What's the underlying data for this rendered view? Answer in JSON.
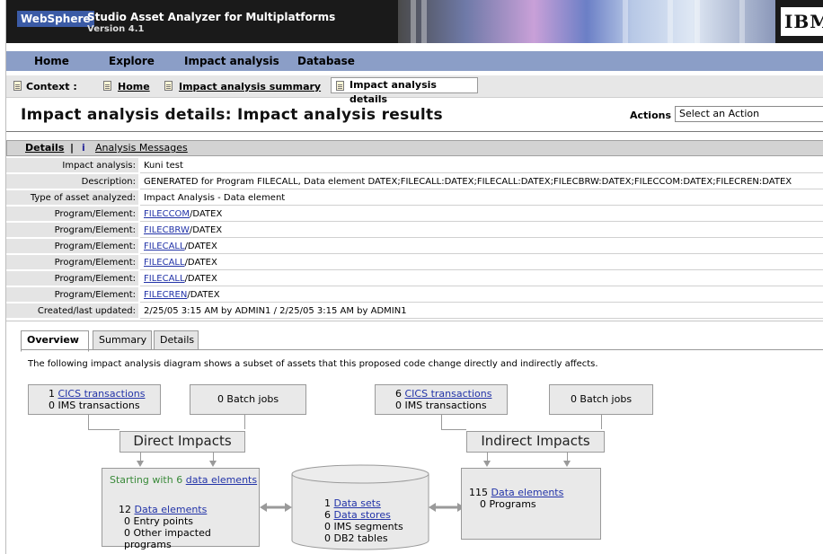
{
  "banner": {
    "brand": "WebSphere",
    "product": "Studio Asset Analyzer for Multiplatforms",
    "version": "Version 4.1",
    "vendor_logo": "IBM"
  },
  "nav": [
    "Home",
    "Explore",
    "Impact analysis",
    "Database"
  ],
  "context": {
    "label": "Context :",
    "crumbs": [
      "Home",
      "Impact analysis summary"
    ],
    "current": "Impact analysis details"
  },
  "page": {
    "title": "Impact analysis details: Impact analysis results",
    "actions_label": "Actions",
    "actions_placeholder": "Select an Action"
  },
  "details": {
    "tab_details": "Details",
    "separator": "|",
    "info_icon": "i",
    "tab_messages": "Analysis Messages",
    "rows": [
      {
        "key": "Impact analysis:",
        "value": "Kuni test"
      },
      {
        "key": "Description:",
        "value": "GENERATED for Program FILECALL, Data element DATEX;FILECALL:DATEX;FILECALL:DATEX;FILECBRW:DATEX;FILECCOM:DATEX;FILECREN:DATEX"
      },
      {
        "key": "Type of asset analyzed:",
        "value": "Impact Analysis - Data element"
      },
      {
        "key": "Program/Element:",
        "link": "FILECCOM",
        "suffix": "/DATEX"
      },
      {
        "key": "Program/Element:",
        "link": "FILECBRW",
        "suffix": "/DATEX"
      },
      {
        "key": "Program/Element:",
        "link": "FILECALL",
        "suffix": "/DATEX"
      },
      {
        "key": "Program/Element:",
        "link": "FILECALL",
        "suffix": "/DATEX"
      },
      {
        "key": "Program/Element:",
        "link": "FILECALL",
        "suffix": "/DATEX"
      },
      {
        "key": "Program/Element:",
        "link": "FILECREN",
        "suffix": "/DATEX"
      },
      {
        "key": "Created/last updated:",
        "value": "2/25/05 3:15 AM by ADMIN1 / 2/25/05 3:15 AM by ADMIN1"
      }
    ]
  },
  "tabs": [
    "Overview",
    "Summary",
    "Details"
  ],
  "intro": "The following impact analysis diagram shows a subset of assets that this proposed code change directly and indirectly affects.",
  "diagram": {
    "direct": {
      "cics_count": "1",
      "cics_link": "CICS transactions",
      "ims": "0 IMS transactions",
      "batch": "0 Batch jobs",
      "label": "Direct Impacts",
      "starting_prefix": "Starting with 6 ",
      "starting_link": "data elements",
      "de_count": "12",
      "de_link": "Data elements",
      "entry_points": "0 Entry points",
      "other_programs": "0 Other impacted programs"
    },
    "indirect": {
      "cics_count": "6",
      "cics_link": "CICS transactions",
      "ims": "0 IMS transactions",
      "batch": "0 Batch jobs",
      "label": "Indirect Impacts",
      "de_count": "115",
      "de_link": "Data elements",
      "programs": "0 Programs"
    },
    "store": {
      "sets_count": "1",
      "sets_link": "Data sets",
      "stores_count": "6",
      "stores_link": "Data stores",
      "ims_segments": "0 IMS segments",
      "db2_tables": "0 DB2 tables"
    }
  },
  "colors": {
    "nav": "#8b9ec7",
    "link": "#2233a8",
    "brand": "#3b5ba6",
    "green": "#3a8a3a"
  }
}
